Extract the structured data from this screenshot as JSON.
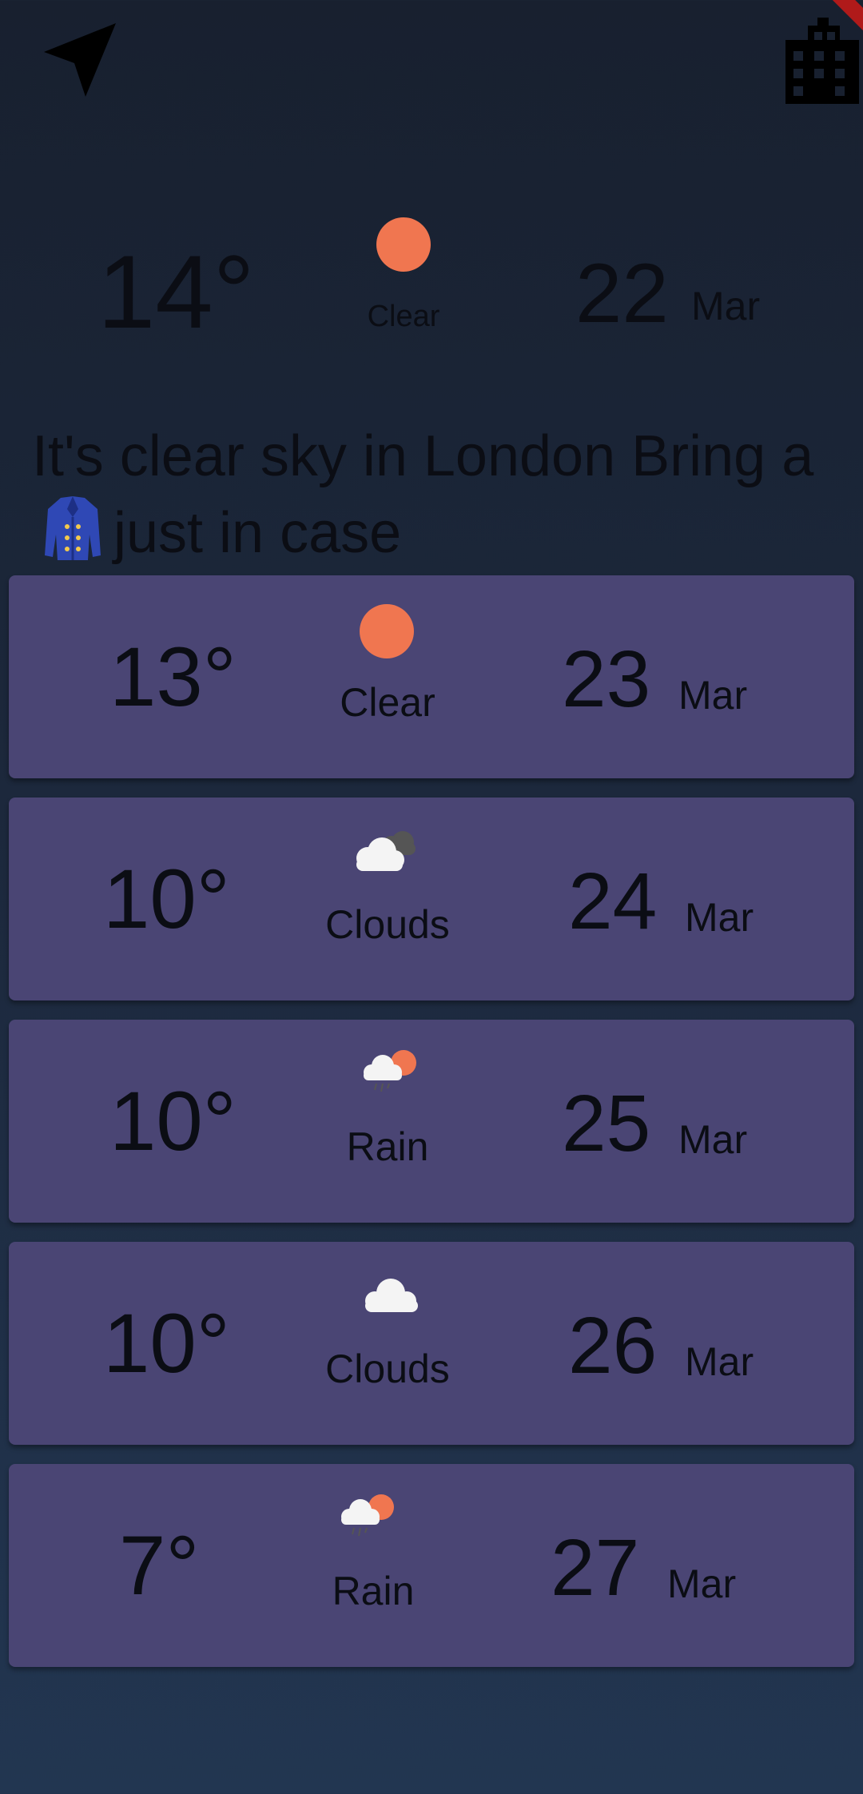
{
  "app": {
    "accent_card": "#4a4574",
    "sun_color": "#f07650"
  },
  "toolbar": {
    "location_icon": "navigation-arrow-icon",
    "city_icon": "city-buildings-icon"
  },
  "current": {
    "temp": "14°",
    "condition": "Clear",
    "day": "22",
    "month": "Mar",
    "icon": "sun-icon"
  },
  "message": {
    "before": "It's clear sky in London Bring a",
    "emoji": "coat-icon",
    "after": "just in case"
  },
  "forecast": [
    {
      "temp": "13°",
      "condition": "Clear",
      "day": "23",
      "month": "Mar",
      "icon": "sun-icon"
    },
    {
      "temp": "10°",
      "condition": "Clouds",
      "day": "24",
      "month": "Mar",
      "icon": "clouds-icon"
    },
    {
      "temp": "10°",
      "condition": "Rain",
      "day": "25",
      "month": "Mar",
      "icon": "rain-icon"
    },
    {
      "temp": "10°",
      "condition": "Clouds",
      "day": "26",
      "month": "Mar",
      "icon": "cloud-icon"
    },
    {
      "temp": "7°",
      "condition": "Rain",
      "day": "27",
      "month": "Mar",
      "icon": "rain-icon"
    }
  ]
}
